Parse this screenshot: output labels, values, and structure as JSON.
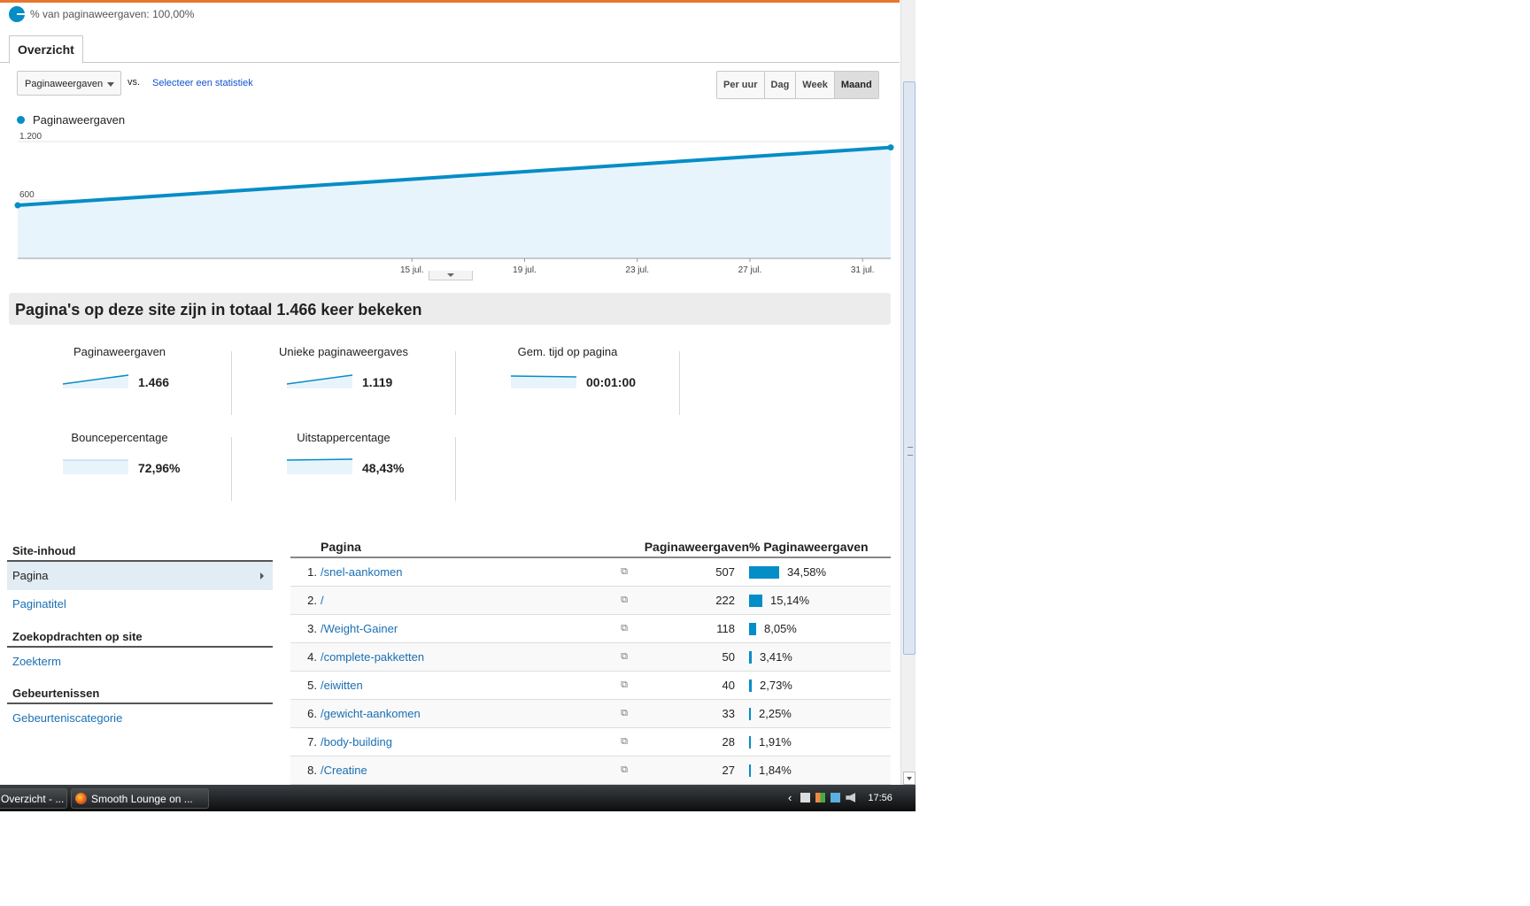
{
  "segment": {
    "label": "% van paginaweergaven: 100,00%"
  },
  "tabs": [
    {
      "label": "Overzicht"
    }
  ],
  "controls": {
    "metric_select": "Paginaweergaven",
    "vs": "vs.",
    "select_stat": "Selecteer een statistiek",
    "periods": [
      "Per uur",
      "Dag",
      "Week",
      "Maand"
    ],
    "active_period": "Maand"
  },
  "chart_data": {
    "type": "area",
    "series": [
      {
        "name": "Paginaweergaven",
        "x": [
          "2012-07-01",
          "2012-08-01"
        ],
        "values": [
          545,
          1140
        ]
      }
    ],
    "ylim": [
      0,
      1200
    ],
    "ytick_values": [
      600,
      1200
    ],
    "ytick_labels": [
      "600",
      "1.200"
    ],
    "xtick_labels": [
      "15 jul.",
      "19 jul.",
      "23 jul.",
      "27 jul.",
      "31 jul."
    ],
    "xtick_x": [
      "2012-07-15",
      "2012-07-19",
      "2012-07-23",
      "2012-07-27",
      "2012-07-31"
    ],
    "color": "#058dc7",
    "fill": "#e8f4fb",
    "grid": true,
    "legend": "top-left"
  },
  "summary": {
    "title": "Pagina's op deze site zijn in totaal 1.466 keer bekeken"
  },
  "stats": [
    {
      "label": "Paginaweergaven",
      "value": "1.466",
      "trend": "up"
    },
    {
      "label": "Unieke paginaweergaves",
      "value": "1.119",
      "trend": "up"
    },
    {
      "label": "Gem. tijd op pagina",
      "value": "00:01:00",
      "trend": "flat"
    },
    {
      "label": "Bouncepercentage",
      "value": "72,96%",
      "trend": "flat"
    },
    {
      "label": "Uitstappercentage",
      "value": "48,43%",
      "trend": "flat"
    }
  ],
  "sidebar": {
    "sections": [
      {
        "title": "Site-inhoud",
        "items": [
          "Pagina",
          "Paginatitel"
        ]
      },
      {
        "title": "Zoekopdrachten op site",
        "items": [
          "Zoekterm"
        ]
      },
      {
        "title": "Gebeurtenissen",
        "items": [
          "Gebeurteniscategorie"
        ]
      }
    ],
    "active_item": "Pagina"
  },
  "table": {
    "headers": {
      "page": "Pagina",
      "views": "Paginaweergaven",
      "pct": "% Paginaweergaven"
    },
    "rows": [
      {
        "rank": "1.",
        "page": "/snel-aankomen",
        "views": "507",
        "pct": "34,58%",
        "pct_value": 34.58
      },
      {
        "rank": "2.",
        "page": "/",
        "views": "222",
        "pct": "15,14%",
        "pct_value": 15.14
      },
      {
        "rank": "3.",
        "page": "/Weight-Gainer",
        "views": "118",
        "pct": "8,05%",
        "pct_value": 8.05
      },
      {
        "rank": "4.",
        "page": "/complete-pakketten",
        "views": "50",
        "pct": "3,41%",
        "pct_value": 3.41
      },
      {
        "rank": "5.",
        "page": "/eiwitten",
        "views": "40",
        "pct": "2,73%",
        "pct_value": 2.73
      },
      {
        "rank": "6.",
        "page": "/gewicht-aankomen",
        "views": "33",
        "pct": "2,25%",
        "pct_value": 2.25
      },
      {
        "rank": "7.",
        "page": "/body-building",
        "views": "28",
        "pct": "1,91%",
        "pct_value": 1.91
      },
      {
        "rank": "8.",
        "page": "/Creatine",
        "views": "27",
        "pct": "1,84%",
        "pct_value": 1.84
      }
    ]
  },
  "taskbar": {
    "items": [
      "Overzicht - ...",
      "Smooth Lounge on ..."
    ],
    "time": "17:56"
  }
}
